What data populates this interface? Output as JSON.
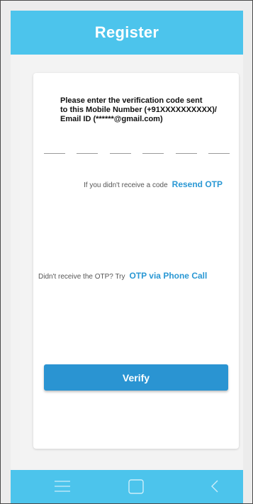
{
  "header": {
    "title": "Register"
  },
  "instruction": {
    "line1": "Please enter the verification code sent",
    "line2": "to this Mobile Number (+91XXXXXXXXXX)/",
    "line3": "Email ID (******@gmail.com)"
  },
  "otp": {
    "slots": 6
  },
  "resend": {
    "prompt": "If you didn't receive a code",
    "link": "Resend OTP"
  },
  "phone_call": {
    "prompt": "Didn't receive the OTP? Try",
    "link": "OTP via Phone Call"
  },
  "verify_button": {
    "label": "Verify"
  },
  "navbar": {
    "icons": [
      "menu-icon",
      "home-icon",
      "back-icon"
    ]
  },
  "colors": {
    "header_bg": "#4cc4ec",
    "button_bg": "#2a94d2",
    "link": "#2a98d4"
  }
}
